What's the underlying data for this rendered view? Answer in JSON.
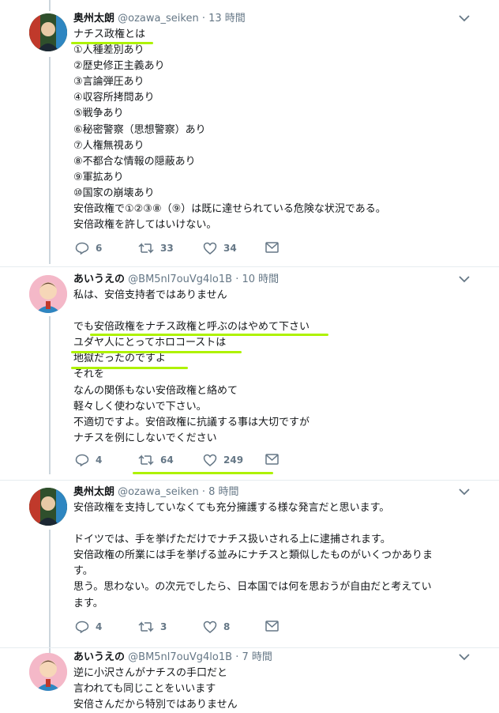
{
  "colors": {
    "highlight": "#aef200",
    "thread": "#ccd6dd",
    "muted": "#657786"
  },
  "tweets": [
    {
      "name": "奥州太朗",
      "handle": "@ozawa_seiken",
      "time": "13 時間",
      "lines": [
        "ナチス政権とは",
        "①人種差別あり",
        "②歴史修正主義あり",
        "③言論弾圧あり",
        "④収容所拷問あり",
        "⑤戦争あり",
        "⑥秘密警察（思想警察）あり",
        "⑦人権無視あり",
        "⑧不都合な情報の隠蔽あり",
        "⑨軍拡あり",
        "⑩国家の崩壊あり",
        "安倍政権で①②③⑧（⑨）は既に達せられている危険な状況である。",
        "安倍政権を許してはいけない。"
      ],
      "reply": "6",
      "retweet": "33",
      "like": "34"
    },
    {
      "name": "あいうえの",
      "handle": "@BM5nl7ouVg4lo1B",
      "time": "10 時間",
      "lines": [
        "私は、安倍支持者ではありません",
        "",
        "でも安倍政権をナチス政権と呼ぶのはやめて下さい",
        "ユダヤ人にとってホロコーストは",
        "地獄だったのですよ",
        "それを",
        "なんの関係もない安倍政権と絡めて",
        "軽々しく使わないで下さい。",
        "不適切ですよ。安倍政権に抗議する事は大切ですが",
        "ナチスを例にしないでください"
      ],
      "reply": "4",
      "retweet": "64",
      "like": "249"
    },
    {
      "name": "奥州太朗",
      "handle": "@ozawa_seiken",
      "time": "8 時間",
      "lines": [
        "安倍政権を支持していなくても充分擁護する様な発言だと思います。",
        "",
        "ドイツでは、手を挙げただけでナチス扱いされる上に逮捕されます。",
        "安倍政権の所業には手を挙げる並みにナチスと類似したものがいくつかありま",
        "す。",
        "思う。思わない。の次元でしたら、日本国では何を思おうが自由だと考えてい",
        "ます。"
      ],
      "reply": "4",
      "retweet": "3",
      "like": "8"
    },
    {
      "name": "あいうえの",
      "handle": "@BM5nl7ouVg4lo1B",
      "time": "7 時間",
      "lines": [
        "逆に小沢さんがナチスの手口だと",
        "言われても同じことをいいます",
        "安倍さんだから特別ではありません"
      ]
    }
  ]
}
